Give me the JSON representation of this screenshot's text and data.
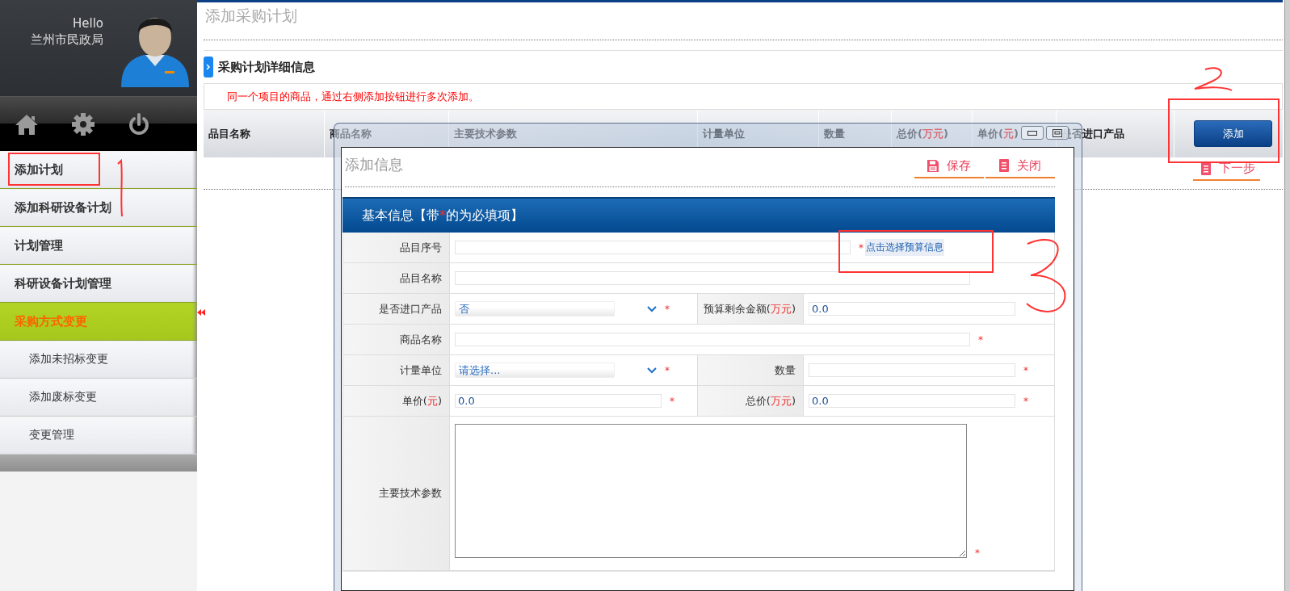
{
  "sidebar": {
    "greeting": "Hello",
    "user_name": "兰州市民政局",
    "items": [
      {
        "label": "添加计划",
        "selected": false
      },
      {
        "label": "添加科研设备计划",
        "selected": false
      },
      {
        "label": "计划管理",
        "selected": false
      },
      {
        "label": "科研设备计划管理",
        "selected": false
      },
      {
        "label": "采购方式变更",
        "selected": true,
        "expanded": true,
        "children": [
          {
            "label": "添加未招标变更",
            "selected": false
          },
          {
            "label": "添加废标变更",
            "selected": false
          },
          {
            "label": "变更管理",
            "selected": false
          }
        ]
      }
    ]
  },
  "main": {
    "title": "添加采购计划",
    "section_title": "采购计划详细信息",
    "notice": "同一个项目的商品，通过右侧添加按钮进行多次添加。",
    "table": {
      "columns": [
        [
          {
            "text": "品目名称",
            "emphasis": false
          }
        ],
        [
          {
            "text": "商品名称",
            "emphasis": false
          }
        ],
        [
          {
            "text": "主要技术参数",
            "emphasis": false
          }
        ],
        [
          {
            "text": "计量单位",
            "emphasis": false
          }
        ],
        [
          {
            "text": "数量",
            "emphasis": false
          }
        ],
        [
          {
            "text": "总价(",
            "emphasis": false
          },
          {
            "text": "万元",
            "emphasis": true
          },
          {
            "text": ")",
            "emphasis": false
          }
        ],
        [
          {
            "text": "单价(",
            "emphasis": false
          },
          {
            "text": "元",
            "emphasis": true
          },
          {
            "text": ")",
            "emphasis": false
          }
        ],
        [
          {
            "text": "是否进口产品",
            "emphasis": false
          }
        ]
      ]
    },
    "add_button": "添加",
    "next_link": "下一步"
  },
  "dialog": {
    "title": "添加信息",
    "actions": [
      {
        "kind": "save",
        "label": "保存"
      },
      {
        "kind": "close",
        "label": "关闭"
      }
    ],
    "section_title": [
      {
        "text": "基本信息【带",
        "emphasis": false
      },
      {
        "text": "*",
        "emphasis": true
      },
      {
        "text": "的为必填项】",
        "emphasis": false
      }
    ],
    "rows": [
      {
        "fields": [
          {
            "label": [
              {
                "text": "品目序号",
                "emphasis": false
              }
            ],
            "kind": "text",
            "required_mark": "*",
            "link": "点击选择预算信息"
          }
        ]
      },
      {
        "fields": [
          {
            "label": [
              {
                "text": "品目名称",
                "emphasis": false
              }
            ],
            "kind": "text"
          }
        ]
      },
      {
        "fields": [
          {
            "label": [
              {
                "text": "是否进口产品",
                "emphasis": false
              }
            ],
            "kind": "select",
            "value": "否",
            "required_mark": "*"
          },
          {
            "label": [
              {
                "text": "预算剩余金额(",
                "emphasis": false
              },
              {
                "text": "万元",
                "emphasis": true
              },
              {
                "text": ")",
                "emphasis": false
              }
            ],
            "kind": "text",
            "value": "0.0"
          }
        ]
      },
      {
        "fields": [
          {
            "label": [
              {
                "text": "商品名称",
                "emphasis": false
              }
            ],
            "kind": "text",
            "required_mark": "*"
          }
        ]
      },
      {
        "fields": [
          {
            "label": [
              {
                "text": "计量单位",
                "emphasis": false
              }
            ],
            "kind": "select",
            "value": "请选择...",
            "required_mark": "*"
          },
          {
            "label": [
              {
                "text": "数量",
                "emphasis": false
              }
            ],
            "kind": "text",
            "required_mark": "*"
          }
        ]
      },
      {
        "fields": [
          {
            "label": [
              {
                "text": "单价(",
                "emphasis": false
              },
              {
                "text": "元",
                "emphasis": true
              },
              {
                "text": ")",
                "emphasis": false
              }
            ],
            "kind": "text",
            "value": "0.0",
            "required_mark": "*"
          },
          {
            "label": [
              {
                "text": "总价(",
                "emphasis": false
              },
              {
                "text": "万元",
                "emphasis": true
              },
              {
                "text": ")",
                "emphasis": false
              }
            ],
            "kind": "text",
            "value": "0.0",
            "required_mark": "*"
          }
        ]
      },
      {
        "fields": [
          {
            "label": [
              {
                "text": "主要技术参数",
                "emphasis": false
              }
            ],
            "kind": "textarea",
            "required_mark": "*"
          }
        ]
      }
    ]
  }
}
